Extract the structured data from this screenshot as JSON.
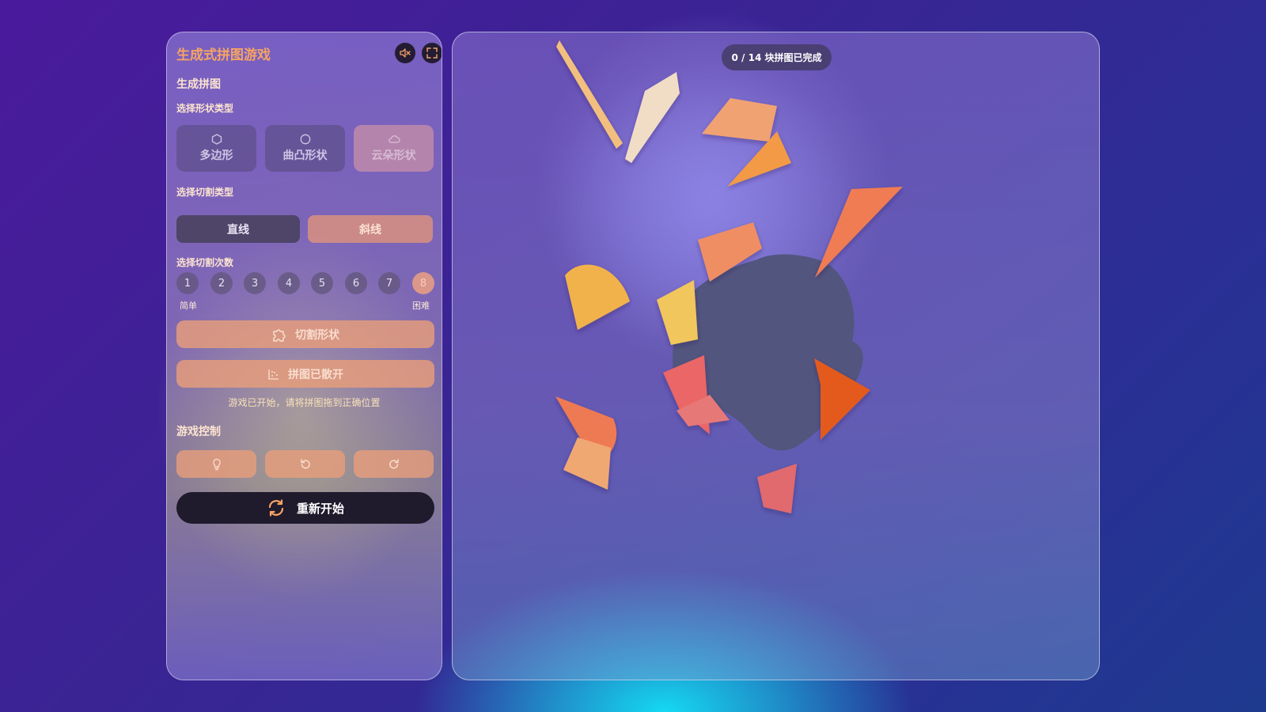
{
  "app": {
    "title": "生成式拼图游戏",
    "mute_icon": "speaker-muted-icon",
    "fullscreen_icon": "fullscreen-icon"
  },
  "generate": {
    "section_title": "生成拼图",
    "shape_type_label": "选择形状类型",
    "shapes": [
      {
        "label": "多边形",
        "icon": "hexagon-icon",
        "enabled": true
      },
      {
        "label": "曲凸形状",
        "icon": "circle-icon",
        "enabled": true
      },
      {
        "label": "云朵形状",
        "icon": "cloud-icon",
        "enabled": false
      }
    ],
    "cut_type_label": "选择切割类型",
    "cut_types": [
      {
        "label": "直线",
        "active": true
      },
      {
        "label": "斜线",
        "active": false
      }
    ],
    "cut_count_label": "选择切割次数",
    "cut_counts": [
      "1",
      "2",
      "3",
      "4",
      "5",
      "6",
      "7",
      "8"
    ],
    "selected_cut_count": "8",
    "easy_label": "简单",
    "hard_label": "困难",
    "cut_button_label": "切割形状",
    "scatter_button_label": "拼图已散开",
    "status_text": "游戏已开始，请将拼图拖到正确位置"
  },
  "controls": {
    "section_title": "游戏控制",
    "buttons": [
      {
        "icon": "lightbulb-hint-icon"
      },
      {
        "icon": "undo-icon"
      },
      {
        "icon": "redo-icon"
      }
    ],
    "restart_label": "重新开始"
  },
  "board": {
    "progress_text": "0 / 14 块拼图已完成",
    "completed_pieces": 0,
    "total_pieces": 14,
    "target_color": "#52557e",
    "piece_colors": [
      "#f2bf7e",
      "#f1dcc6",
      "#f1a273",
      "#f29a45",
      "#ef7b52",
      "#ef8e63",
      "#f2b24c",
      "#f1c65c",
      "#eb6666",
      "#ee7a53",
      "#f0a873",
      "#e77878",
      "#e35a1e",
      "#e06a6e"
    ]
  },
  "colors": {
    "accent_orange": "#f6a463",
    "panel_button": "#e89e7a",
    "dark_button": "#1f1a2c"
  }
}
